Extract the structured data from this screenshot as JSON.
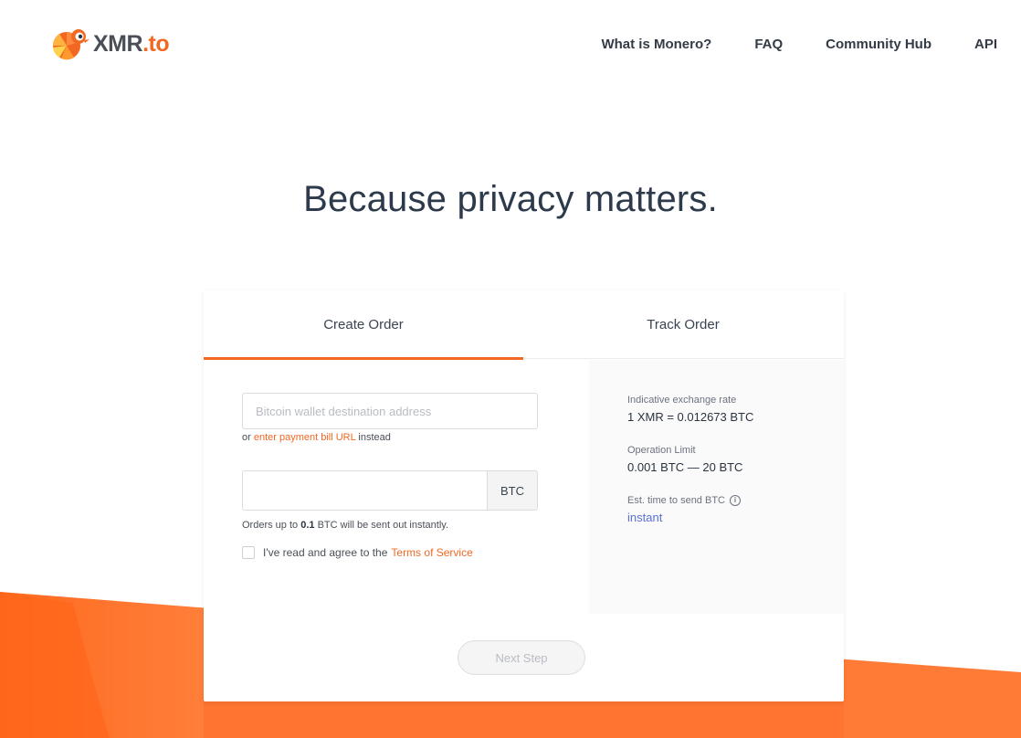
{
  "header": {
    "logo_text": "XMR",
    "logo_suffix": ".to",
    "nav": [
      {
        "label": "What is Monero?"
      },
      {
        "label": "FAQ"
      },
      {
        "label": "Community Hub"
      },
      {
        "label": "API"
      }
    ]
  },
  "hero": {
    "title": "Because privacy matters."
  },
  "card": {
    "tabs": [
      {
        "label": "Create Order",
        "active": true
      },
      {
        "label": "Track Order",
        "active": false
      }
    ],
    "form": {
      "address_placeholder": "Bitcoin wallet destination address",
      "alt_prefix": "or",
      "alt_link": "enter payment bill URL",
      "alt_suffix": "instead",
      "amount_value": "",
      "amount_unit": "BTC",
      "note_prefix": "Orders up to",
      "note_amount": "0.1",
      "note_suffix": "BTC will be sent out instantly.",
      "terms_prefix": "I've read and agree to the",
      "terms_link": "Terms of Service",
      "terms_checked": false
    },
    "info": {
      "rate_label": "Indicative exchange rate",
      "rate_value": "1 XMR = 0.012673 BTC",
      "limit_label": "Operation Limit",
      "limit_value": "0.001 BTC — 20 BTC",
      "time_label": "Est. time to send BTC",
      "time_value": "instant"
    },
    "next_button": "Next Step"
  },
  "colors": {
    "accent": "#f26822",
    "text": "#2b3440",
    "link_blue": "#5a6fd6"
  },
  "icons": {
    "logo": "chameleon-logo-icon",
    "info": "info-circle-icon"
  }
}
